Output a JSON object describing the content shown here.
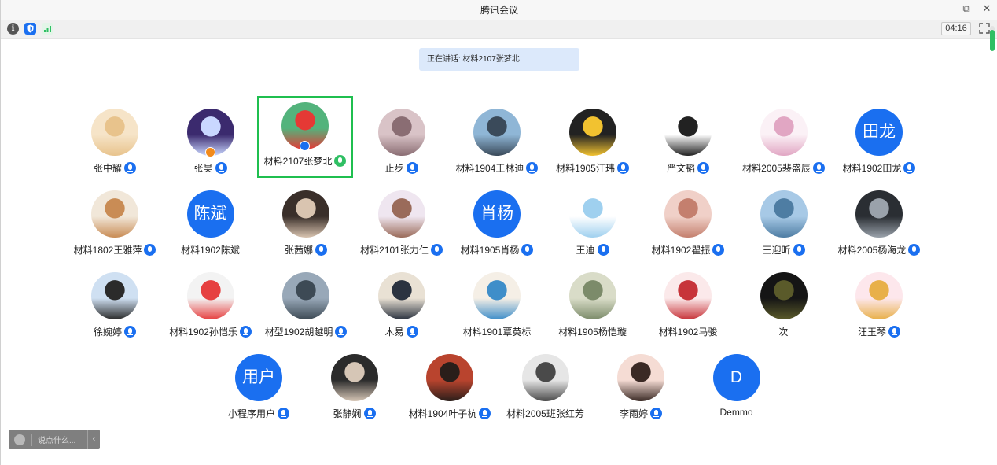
{
  "window": {
    "title": "腾讯会议",
    "controls": [
      "minimize",
      "restore",
      "close"
    ]
  },
  "toolbar": {
    "icons": [
      "info-icon",
      "shield-icon",
      "signal-icon"
    ],
    "timer": "04:16",
    "fullscreen_icon": "fullscreen-icon"
  },
  "speaking_banner": "正在讲话: 材料2107张梦北",
  "mic_level": 0.85,
  "colors": {
    "accent": "#1a6ff0",
    "active_border": "#1fbf4f",
    "speaking_bg": "#dce9fb",
    "mic_active": "#2fbf63"
  },
  "participants": [
    [
      {
        "name": "张中耀",
        "avatar": "photo",
        "colors": [
          "#f6e4c8",
          "#e8c38c"
        ]
      },
      {
        "name": "张昊",
        "avatar": "photo",
        "colors": [
          "#3b2a6e",
          "#c9d7ff"
        ],
        "badge": "cohost"
      },
      {
        "name": "材料2107张梦北",
        "avatar": "photo",
        "colors": [
          "#53b37c",
          "#e53935"
        ],
        "badge": "host",
        "active": true
      },
      {
        "name": "止步",
        "avatar": "photo",
        "colors": [
          "#d9c3c7",
          "#8a6d73"
        ]
      },
      {
        "name": "材料1904王林迪",
        "avatar": "photo",
        "colors": [
          "#8fb6d6",
          "#3a4a5a"
        ]
      },
      {
        "name": "材料1905汪玮",
        "avatar": "photo",
        "colors": [
          "#222222",
          "#f2c230"
        ]
      },
      {
        "name": "严文韬",
        "avatar": "photo",
        "colors": [
          "#ffffff",
          "#222222"
        ]
      },
      {
        "name": "材料2005裴盛辰",
        "avatar": "photo",
        "colors": [
          "#fbf1f6",
          "#e1a6c3"
        ]
      },
      {
        "name": "材料1902田龙",
        "avatar": "text",
        "initials": "田龙"
      }
    ],
    [
      {
        "name": "材料1802王雅萍",
        "avatar": "photo",
        "colors": [
          "#f1e7d9",
          "#c98c55"
        ]
      },
      {
        "name": "材料1902陈斌",
        "avatar": "text",
        "initials": "陈斌",
        "no_mic": true
      },
      {
        "name": "张茜娜",
        "avatar": "photo",
        "colors": [
          "#3a2f2a",
          "#d9c4b0"
        ]
      },
      {
        "name": "材料2101张力仁",
        "avatar": "photo",
        "colors": [
          "#efe6f0",
          "#9a6b5a"
        ]
      },
      {
        "name": "材料1905肖杨",
        "avatar": "text",
        "initials": "肖杨"
      },
      {
        "name": "王迪",
        "avatar": "photo",
        "colors": [
          "#ffffff",
          "#9fd0ef"
        ]
      },
      {
        "name": "材料1902瞿振",
        "avatar": "photo",
        "colors": [
          "#f0d0c8",
          "#c47f6e"
        ]
      },
      {
        "name": "王迎昕",
        "avatar": "photo",
        "colors": [
          "#a7c9e6",
          "#4e7da3"
        ]
      },
      {
        "name": "材料2005杨海龙",
        "avatar": "photo",
        "colors": [
          "#2a2e33",
          "#9aa2ab"
        ]
      }
    ],
    [
      {
        "name": "徐婉婷",
        "avatar": "photo",
        "colors": [
          "#cfe0f2",
          "#2b2b2b"
        ]
      },
      {
        "name": "材料1902孙恺乐",
        "avatar": "photo",
        "colors": [
          "#f3f3f3",
          "#e64040"
        ]
      },
      {
        "name": "材型1902胡越明",
        "avatar": "photo",
        "colors": [
          "#98a8b8",
          "#3d4a55"
        ]
      },
      {
        "name": "木易",
        "avatar": "photo",
        "colors": [
          "#e9e1d4",
          "#2b3340"
        ]
      },
      {
        "name": "材料1901覃英标",
        "avatar": "photo",
        "colors": [
          "#f5efe6",
          "#3f8ec9"
        ],
        "no_mic": true
      },
      {
        "name": "材料1905杨恺璇",
        "avatar": "photo",
        "colors": [
          "#d9dcc8",
          "#7c8b6a"
        ],
        "no_mic": true
      },
      {
        "name": "材料1902马骏",
        "avatar": "photo",
        "colors": [
          "#fbe9ea",
          "#c7343a"
        ],
        "no_mic": true
      },
      {
        "name": "次",
        "avatar": "photo",
        "colors": [
          "#151515",
          "#5a5a2a"
        ],
        "no_mic": true
      },
      {
        "name": "汪玉琴",
        "avatar": "photo",
        "colors": [
          "#fde7ec",
          "#e8b04a"
        ]
      }
    ],
    [
      {
        "name": "小程序用户",
        "avatar": "text",
        "initials": "用户"
      },
      {
        "name": "张静娴",
        "avatar": "photo",
        "colors": [
          "#2b2b2b",
          "#d6c6b6"
        ]
      },
      {
        "name": "材料1904叶子杭",
        "avatar": "photo",
        "colors": [
          "#b9442e",
          "#2a1e1a"
        ]
      },
      {
        "name": "材料2005班张红芳",
        "avatar": "photo",
        "colors": [
          "#e6e6e6",
          "#4a4a4a"
        ],
        "no_mic": true
      },
      {
        "name": "李雨婷",
        "avatar": "photo",
        "colors": [
          "#f5dcd4",
          "#3b2a25"
        ]
      },
      {
        "name": "Demmo",
        "avatar": "text",
        "initials": "D",
        "no_mic": true
      }
    ]
  ],
  "chat": {
    "placeholder": "说点什么...",
    "emoji_icon": "smile-icon",
    "collapse_icon": "chevron-left-icon"
  }
}
